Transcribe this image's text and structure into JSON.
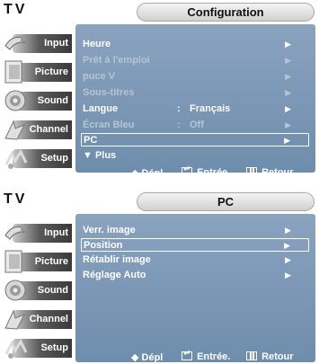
{
  "top": {
    "header": {
      "tv_label": "TV",
      "title": "Configuration"
    },
    "sidebar": [
      {
        "label": "Input",
        "icon": "input-icon"
      },
      {
        "label": "Picture",
        "icon": "picture-icon"
      },
      {
        "label": "Sound",
        "icon": "sound-icon"
      },
      {
        "label": "Channel",
        "icon": "channel-icon"
      },
      {
        "label": "Setup",
        "icon": "setup-icon"
      }
    ],
    "rows": [
      {
        "label": "Heure",
        "value": "",
        "dim": false
      },
      {
        "label": "Prêt à l'emploi",
        "value": "",
        "dim": true
      },
      {
        "label": "puce V",
        "value": "",
        "dim": true
      },
      {
        "label": "Sous-titres",
        "value": "",
        "dim": true
      },
      {
        "label": "Langue",
        "value": "Français",
        "dim": false
      },
      {
        "label": "Écran Bleu",
        "value": "Off",
        "dim": true
      },
      {
        "label": "PC",
        "value": "",
        "dim": false,
        "selected": true
      }
    ],
    "more_label": "▼ Plus",
    "footer": {
      "move": "Dépl",
      "enter": "Entrée.",
      "back": "Retour"
    }
  },
  "bottom": {
    "header": {
      "tv_label": "TV",
      "title": "PC"
    },
    "sidebar": [
      {
        "label": "Input",
        "icon": "input-icon"
      },
      {
        "label": "Picture",
        "icon": "picture-icon"
      },
      {
        "label": "Sound",
        "icon": "sound-icon"
      },
      {
        "label": "Channel",
        "icon": "channel-icon"
      },
      {
        "label": "Setup",
        "icon": "setup-icon"
      }
    ],
    "rows": [
      {
        "label": "Verr. image"
      },
      {
        "label": "Position",
        "selected": true
      },
      {
        "label": "Rétablir image"
      },
      {
        "label": "Réglage Auto"
      }
    ],
    "footer": {
      "move": "Dépl",
      "enter": "Entrée.",
      "back": "Retour"
    }
  },
  "colors": {
    "panel_blue": "#7895b5",
    "dim_text": "#b6c4d4",
    "text": "#ffffff"
  }
}
